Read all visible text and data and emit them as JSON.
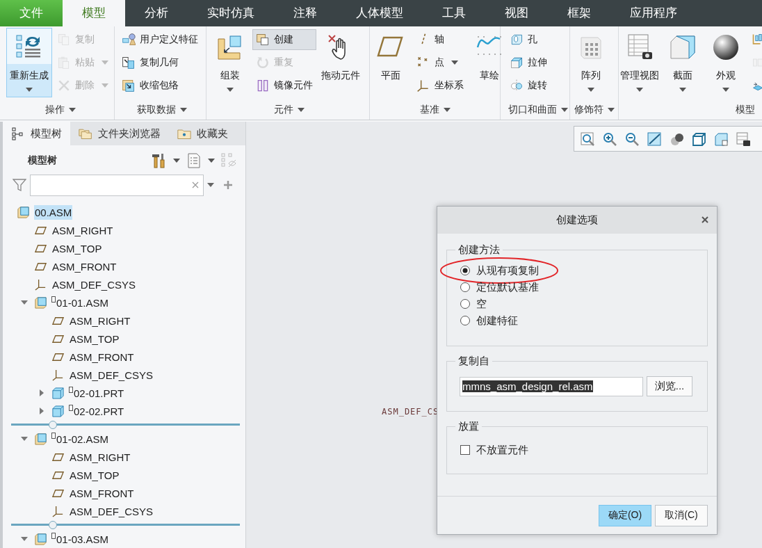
{
  "menu_tabs": [
    {
      "label": "文件",
      "kind": "file",
      "selected": false
    },
    {
      "label": "模型",
      "kind": "tab",
      "selected": true
    },
    {
      "label": "分析",
      "kind": "tab",
      "selected": false
    },
    {
      "label": "实时仿真",
      "kind": "tab",
      "selected": false
    },
    {
      "label": "注释",
      "kind": "tab",
      "selected": false
    },
    {
      "label": "人体模型",
      "kind": "tab",
      "selected": false
    },
    {
      "label": "工具",
      "kind": "tab",
      "selected": false
    },
    {
      "label": "视图",
      "kind": "tab",
      "selected": false
    },
    {
      "label": "框架",
      "kind": "tab",
      "selected": false
    },
    {
      "label": "应用程序",
      "kind": "tab",
      "selected": false
    }
  ],
  "ribbon": {
    "groups": [
      {
        "label": "操作",
        "menu": true,
        "tools": [
          {
            "kind": "large",
            "label": "重新生成",
            "dropdown": true,
            "active": true
          },
          {
            "kind": "stack",
            "buttons": [
              {
                "label": "复制",
                "disabled": true,
                "dropdown": false,
                "active": false
              },
              {
                "label": "粘贴",
                "disabled": true,
                "dropdown": true,
                "active": false
              },
              {
                "label": "删除",
                "disabled": true,
                "dropdown": true,
                "active": false
              }
            ]
          }
        ]
      },
      {
        "label": "获取数据",
        "menu": true,
        "tools": [
          {
            "kind": "stack",
            "buttons": [
              {
                "label": "用户定义特征",
                "disabled": false,
                "dropdown": false,
                "active": false
              },
              {
                "label": "复制几何",
                "disabled": false,
                "dropdown": false,
                "active": false
              },
              {
                "label": "收缩包络",
                "disabled": false,
                "dropdown": false,
                "active": false
              }
            ]
          }
        ]
      },
      {
        "label": "元件",
        "menu": true,
        "tools": [
          {
            "kind": "large",
            "label": "组装",
            "dropdown": true,
            "active": false
          },
          {
            "kind": "stack",
            "buttons": [
              {
                "label": "创建",
                "disabled": false,
                "dropdown": false,
                "active": true
              },
              {
                "label": "重复",
                "disabled": true,
                "dropdown": false,
                "active": false
              },
              {
                "label": "镜像元件",
                "disabled": false,
                "dropdown": false,
                "active": false
              }
            ]
          },
          {
            "kind": "large",
            "label": "拖动元件",
            "dropdown": false,
            "active": false
          }
        ]
      },
      {
        "label": "基准",
        "menu": true,
        "tools": [
          {
            "kind": "large",
            "label": "平面",
            "dropdown": false,
            "active": false
          },
          {
            "kind": "stack",
            "buttons": [
              {
                "label": "轴",
                "disabled": false,
                "dropdown": false,
                "active": false
              },
              {
                "label": "点",
                "disabled": false,
                "dropdown": true,
                "active": false
              },
              {
                "label": "坐标系",
                "disabled": false,
                "dropdown": false,
                "active": false
              }
            ]
          },
          {
            "kind": "large",
            "label": "草绘",
            "dropdown": false,
            "active": false
          }
        ]
      },
      {
        "label": "切口和曲面",
        "menu": true,
        "tools": [
          {
            "kind": "stack",
            "buttons": [
              {
                "label": "孔",
                "disabled": false,
                "dropdown": false,
                "active": false
              },
              {
                "label": "拉伸",
                "disabled": false,
                "dropdown": false,
                "active": false
              },
              {
                "label": "旋转",
                "disabled": false,
                "dropdown": false,
                "active": false
              }
            ]
          }
        ]
      },
      {
        "label": "修饰符",
        "menu": true,
        "tools": [
          {
            "kind": "large",
            "label": "阵列",
            "dropdown": true,
            "active": false
          }
        ]
      },
      {
        "label": "模型",
        "tools": [
          {
            "kind": "large",
            "label": "管理视图",
            "dropdown": true,
            "active": false
          },
          {
            "kind": "large",
            "label": "截面",
            "dropdown": true,
            "active": false
          },
          {
            "kind": "large",
            "label": "外观",
            "dropdown": true,
            "active": false
          },
          {
            "kind": "stack",
            "buttons": [
              {
                "disabled": false,
                "active": false
              },
              {
                "disabled": true,
                "active": false
              },
              {
                "disabled": false,
                "active": false
              }
            ]
          }
        ]
      }
    ]
  },
  "nav_panel": {
    "tabs": [
      {
        "label": "模型树",
        "selected": true
      },
      {
        "label": "文件夹浏览器",
        "selected": false
      },
      {
        "label": "收藏夹",
        "selected": false
      }
    ],
    "title": "模型树",
    "tree": [
      {
        "label": "00.ASM",
        "kind": "assembly",
        "selected": true,
        "children": [
          {
            "label": "ASM_RIGHT",
            "kind": "plane",
            "selected": false
          },
          {
            "label": "ASM_TOP",
            "kind": "plane",
            "selected": false
          },
          {
            "label": "ASM_FRONT",
            "kind": "plane",
            "selected": false
          },
          {
            "label": "ASM_DEF_CSYS",
            "kind": "csys",
            "selected": false
          },
          {
            "label": "01-01.ASM",
            "kind": "assembly",
            "selected": false,
            "marked": true,
            "expanded": true,
            "children": [
              {
                "label": "ASM_RIGHT",
                "kind": "plane",
                "selected": false
              },
              {
                "label": "ASM_TOP",
                "kind": "plane",
                "selected": false
              },
              {
                "label": "ASM_FRONT",
                "kind": "plane",
                "selected": false
              },
              {
                "label": "ASM_DEF_CSYS",
                "kind": "csys",
                "selected": false
              },
              {
                "label": "02-01.PRT",
                "kind": "part",
                "selected": false,
                "marked": true,
                "expanded": false
              },
              {
                "label": "02-02.PRT",
                "kind": "part",
                "selected": false,
                "marked": true,
                "expanded": false
              }
            ]
          },
          {
            "label": "01-02.ASM",
            "kind": "assembly",
            "selected": false,
            "marked": true,
            "expanded": true,
            "children": [
              {
                "label": "ASM_RIGHT",
                "kind": "plane",
                "selected": false
              },
              {
                "label": "ASM_TOP",
                "kind": "plane",
                "selected": false
              },
              {
                "label": "ASM_FRONT",
                "kind": "plane",
                "selected": false
              },
              {
                "label": "ASM_DEF_CSYS",
                "kind": "csys",
                "selected": false
              }
            ]
          },
          {
            "label": "01-03.ASM",
            "kind": "assembly",
            "selected": false,
            "marked": true,
            "expanded": true
          }
        ]
      }
    ]
  },
  "canvas": {
    "labels": [
      "ASM_DEF_CS"
    ]
  },
  "dialog": {
    "title": "创建选项",
    "method": {
      "title": "创建方法",
      "options": [
        {
          "label": "从现有项复制",
          "selected": true,
          "highlighted": true
        },
        {
          "label": "定位默认基准",
          "selected": false,
          "highlighted": false
        },
        {
          "label": "空",
          "selected": false,
          "highlighted": false
        },
        {
          "label": "创建特征",
          "selected": false,
          "highlighted": false
        }
      ]
    },
    "copy_from": {
      "title": "复制自",
      "value": "mmns_asm_design_rel.asm",
      "text_selected": true,
      "browse": "浏览..."
    },
    "placement": {
      "title": "放置",
      "checkbox": {
        "label": "不放置元件",
        "checked": false
      }
    },
    "buttons": [
      {
        "label": "确定(O)",
        "primary": true
      },
      {
        "label": "取消(C)",
        "primary": false
      }
    ]
  }
}
